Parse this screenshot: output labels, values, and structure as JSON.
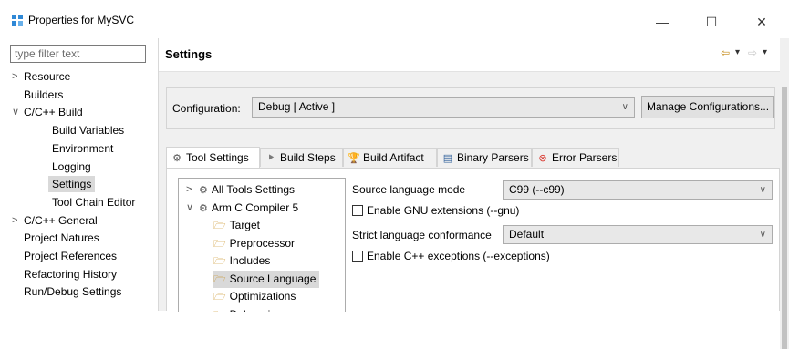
{
  "window": {
    "title": "Properties for MySVC",
    "minimize_glyph": "—",
    "maximize_glyph": "☐",
    "close_glyph": "✕"
  },
  "sidebar": {
    "filter_placeholder": "type filter text",
    "items": [
      {
        "label": "Resource",
        "expander": ">",
        "level": 0
      },
      {
        "label": "Builders",
        "expander": "",
        "level": 0
      },
      {
        "label": "C/C++ Build",
        "expander": "∨",
        "level": 0
      },
      {
        "label": "Build Variables",
        "expander": "",
        "level": 1
      },
      {
        "label": "Environment",
        "expander": "",
        "level": 1
      },
      {
        "label": "Logging",
        "expander": "",
        "level": 1
      },
      {
        "label": "Settings",
        "expander": "",
        "level": 1,
        "selected": true
      },
      {
        "label": "Tool Chain Editor",
        "expander": "",
        "level": 1
      },
      {
        "label": "C/C++ General",
        "expander": ">",
        "level": 0
      },
      {
        "label": "Project Natures",
        "expander": "",
        "level": 0
      },
      {
        "label": "Project References",
        "expander": "",
        "level": 0
      },
      {
        "label": "Refactoring History",
        "expander": "",
        "level": 0
      },
      {
        "label": "Run/Debug Settings",
        "expander": "",
        "level": 0
      }
    ]
  },
  "header": {
    "title": "Settings",
    "back_glyph": "⇦",
    "forward_glyph": "⇨",
    "dropdown_glyph": "▾"
  },
  "configuration": {
    "label": "Configuration:",
    "value": "Debug  [ Active ]",
    "manage_button": "Manage Configurations..."
  },
  "tabs": [
    {
      "label": "Tool Settings",
      "icon": "tool-settings-icon",
      "glyph": "⚙",
      "active": true
    },
    {
      "label": "Build Steps",
      "icon": "build-steps-icon",
      "glyph": "⯈",
      "active": false
    },
    {
      "label": "Build Artifact",
      "icon": "build-artifact-icon",
      "glyph": "🏆",
      "active": false
    },
    {
      "label": "Binary Parsers",
      "icon": "binary-parsers-icon",
      "glyph": "▤",
      "active": false
    },
    {
      "label": "Error Parsers",
      "icon": "error-parsers-icon",
      "glyph": "⊗",
      "active": false
    }
  ],
  "tool_tree": [
    {
      "label": "All Tools Settings",
      "expander": ">",
      "icon": "gear"
    },
    {
      "label": "Arm C Compiler 5",
      "expander": "∨",
      "icon": "gear"
    },
    {
      "label": "Target",
      "expander": "",
      "icon": "folder"
    },
    {
      "label": "Preprocessor",
      "expander": "",
      "icon": "folder"
    },
    {
      "label": "Includes",
      "expander": "",
      "icon": "folder"
    },
    {
      "label": "Source Language",
      "expander": "",
      "icon": "folder",
      "selected": true
    },
    {
      "label": "Optimizations",
      "expander": "",
      "icon": "folder"
    },
    {
      "label": "Debugging",
      "expander": "",
      "icon": "folder"
    }
  ],
  "options": {
    "source_language_mode": {
      "label": "Source language mode",
      "value": "C99 (--c99)"
    },
    "gnu_extensions": {
      "label": "Enable GNU extensions (--gnu)",
      "checked": false
    },
    "strict_conformance": {
      "label": "Strict language conformance",
      "value": "Default"
    },
    "cpp_exceptions": {
      "label": "Enable C++ exceptions (--exceptions)",
      "checked": false
    }
  },
  "colors": {
    "accent_icon": "#2f88d6",
    "nav_arrow": "#c48a16",
    "error_icon": "#d9342b",
    "selection": "#d9d9d9"
  }
}
